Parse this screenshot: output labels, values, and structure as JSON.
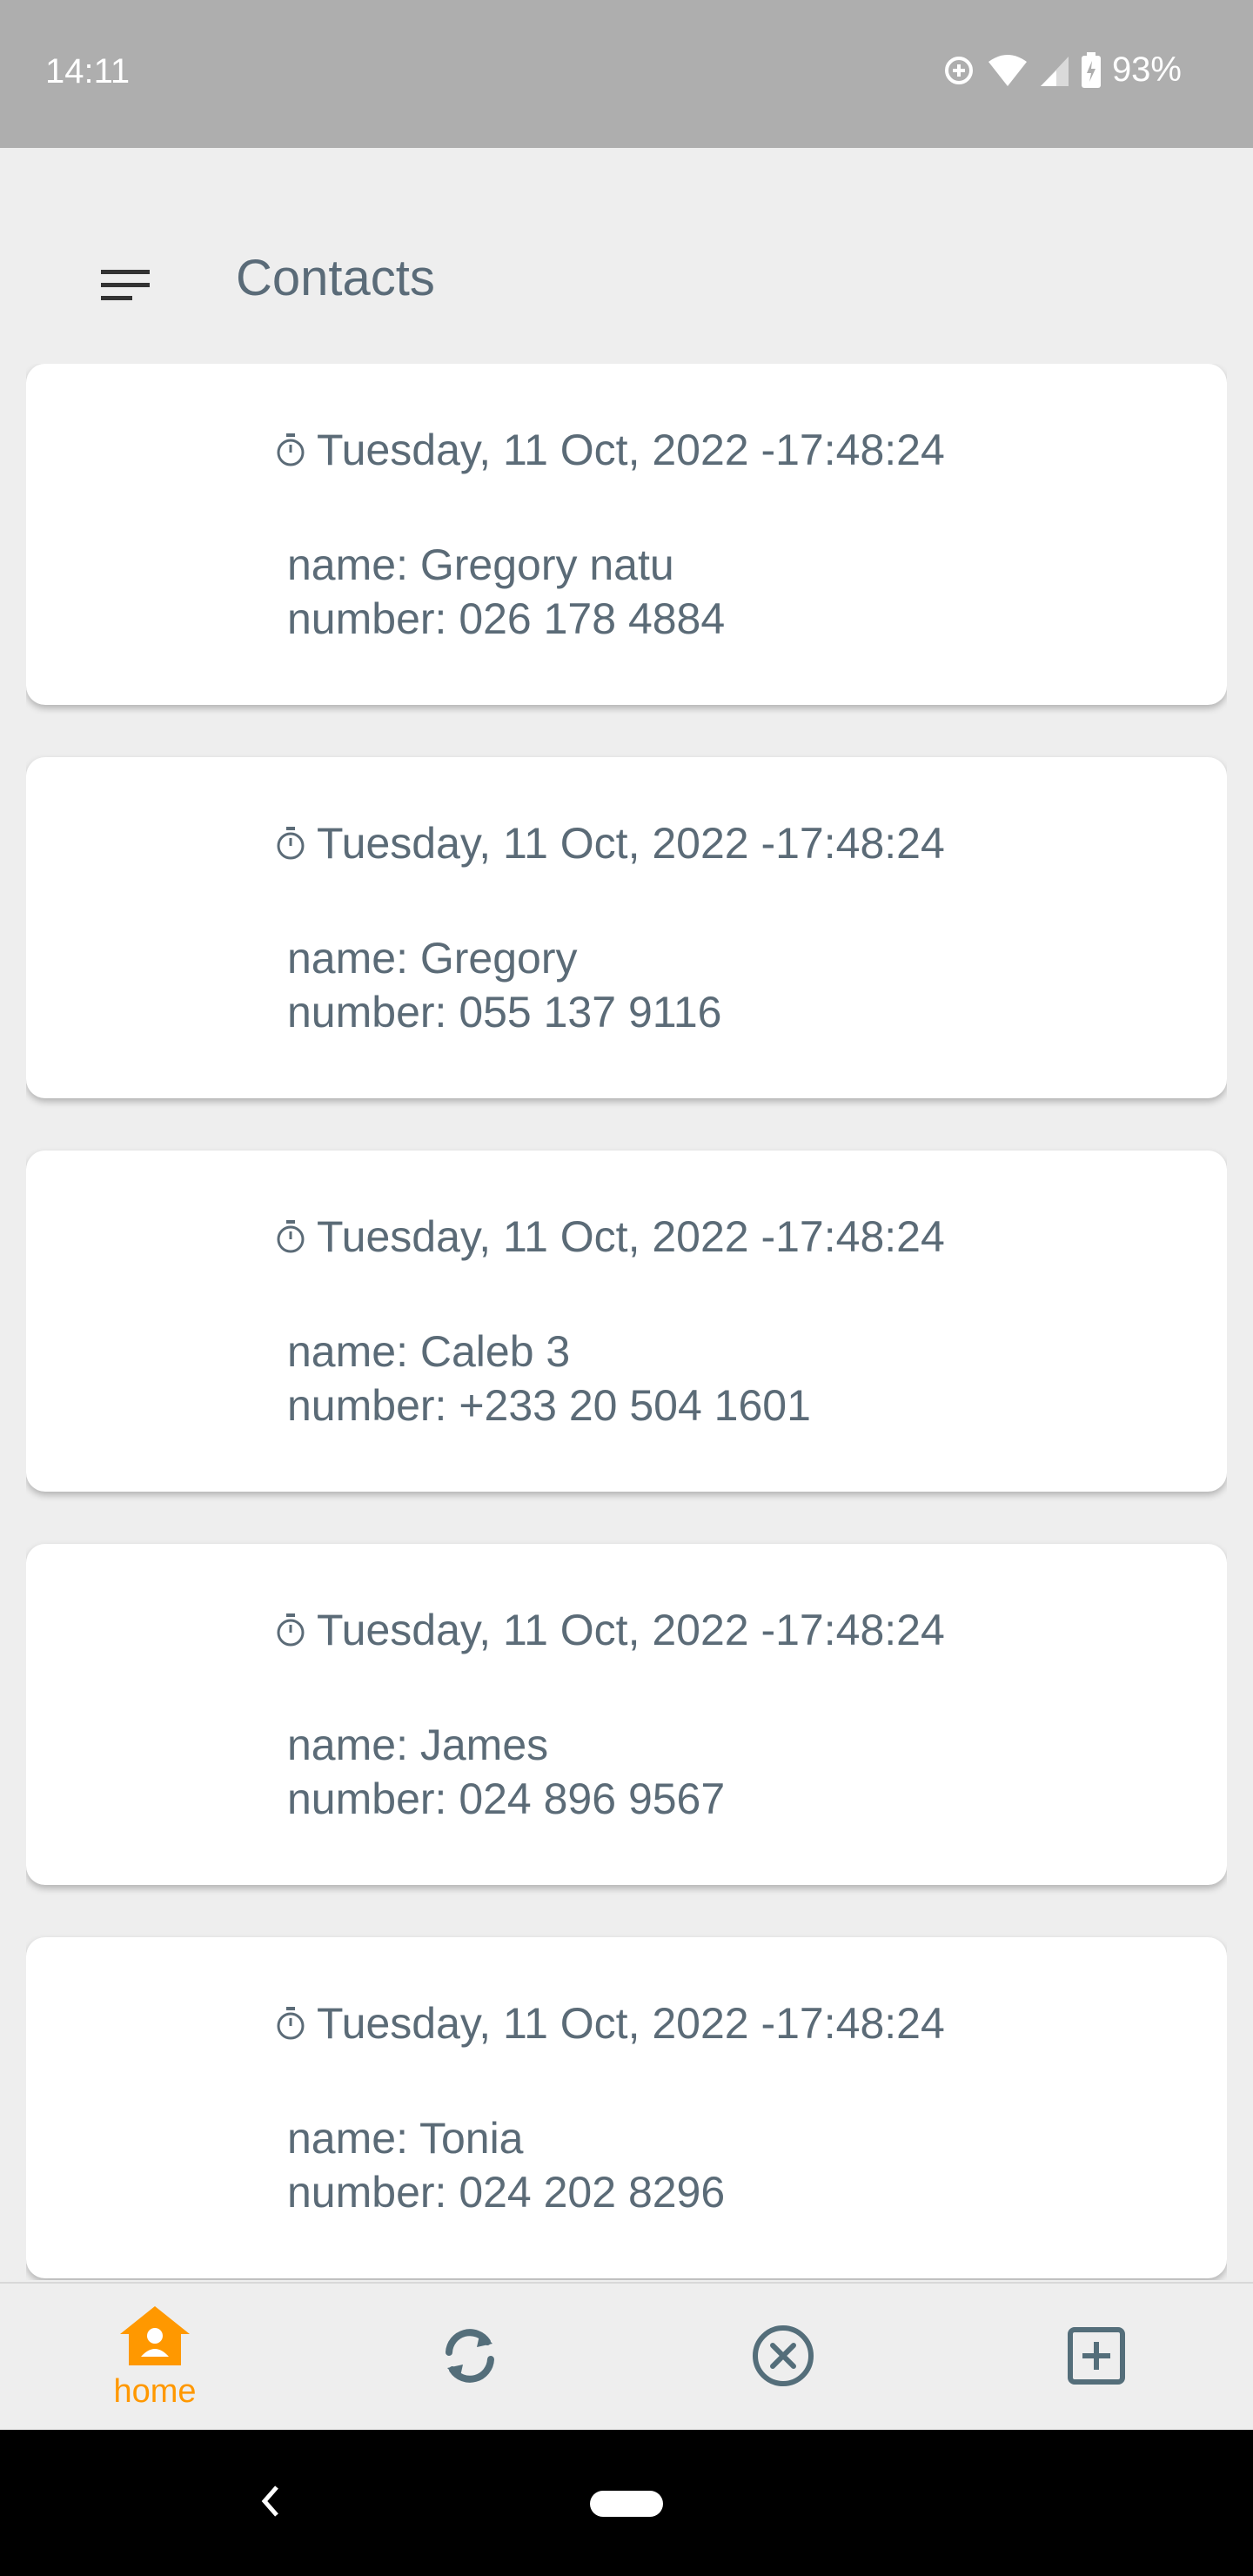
{
  "status_bar": {
    "time": "14:11",
    "battery_percent": "93%",
    "icons": [
      "data-saver-icon",
      "wifi-icon",
      "signal-icon",
      "battery-charging-icon"
    ]
  },
  "app_bar": {
    "title": "Contacts",
    "menu_icon": "menu-icon"
  },
  "contacts": [
    {
      "date": "Tuesday, 11 Oct, 2022 -17:48:24",
      "name": "name: Gregory natu",
      "number": "number: 026 178 4884"
    },
    {
      "date": "Tuesday, 11 Oct, 2022 -17:48:24",
      "name": "name: Gregory",
      "number": "number: 055 137 9116"
    },
    {
      "date": "Tuesday, 11 Oct, 2022 -17:48:24",
      "name": "name: Caleb 3",
      "number": "number: +233 20 504 1601"
    },
    {
      "date": "Tuesday, 11 Oct, 2022 -17:48:24",
      "name": "name: James",
      "number": "number: 024 896 9567"
    },
    {
      "date": "Tuesday, 11 Oct, 2022 -17:48:24",
      "name": "name: Tonia",
      "number": "number: 024 202 8296"
    }
  ],
  "bottom_nav": {
    "items": [
      {
        "label": "home",
        "icon": "home-icon",
        "active": true
      },
      {
        "label": "",
        "icon": "sync-icon",
        "active": false
      },
      {
        "label": "",
        "icon": "cancel-icon",
        "active": false
      },
      {
        "label": "",
        "icon": "add-box-icon",
        "active": false
      }
    ],
    "active_color": "#ff9800",
    "inactive_color": "#546e7a"
  },
  "colors": {
    "background": "#eeeeee",
    "status_bar": "#aeaeae",
    "text": "#5b6b77",
    "card": "#ffffff"
  }
}
